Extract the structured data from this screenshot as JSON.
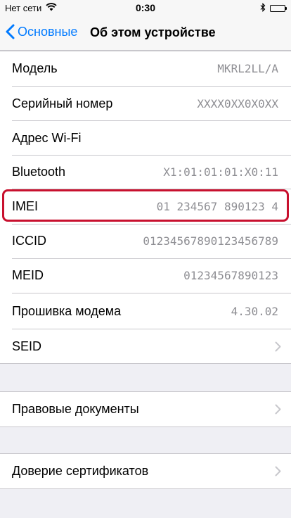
{
  "status_bar": {
    "carrier": "Нет сети",
    "time": "0:30",
    "wifi_icon": "wifi-icon",
    "bluetooth_icon": "bluetooth-icon",
    "battery_icon": "battery-icon"
  },
  "nav": {
    "back_label": "Основные",
    "title": "Об этом устройстве",
    "accent": "#007aff"
  },
  "info_rows": [
    {
      "label": "Модель",
      "value": "MKRL2LL/A"
    },
    {
      "label": "Серийный номер",
      "value": "XXXX0XX0X0XX"
    },
    {
      "label": "Адрес Wi-Fi",
      "value": ""
    },
    {
      "label": "Bluetooth",
      "value": "X1:01:01:01:X0:11"
    },
    {
      "label": "IMEI",
      "value": "01 234567 890123 4"
    },
    {
      "label": "ICCID",
      "value": "01234567890123456789"
    },
    {
      "label": "MEID",
      "value": "01234567890123"
    },
    {
      "label": "Прошивка модема",
      "value": "4.30.02"
    },
    {
      "label": "SEID",
      "value": ""
    }
  ],
  "legal": {
    "label": "Правовые документы"
  },
  "trust": {
    "label": "Доверие сертификатов"
  },
  "highlight_color": "#c8102e"
}
